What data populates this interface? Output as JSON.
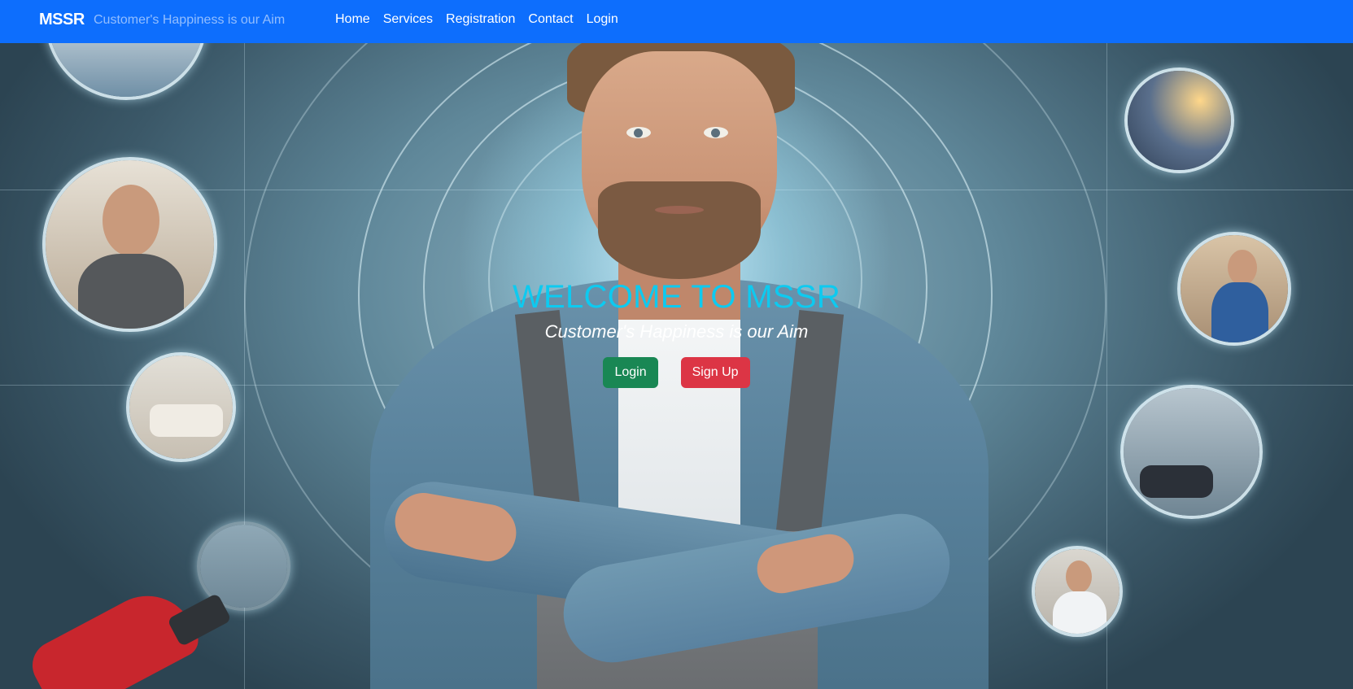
{
  "navbar": {
    "brand": "MSSR",
    "tagline": "Customer's Happiness is our Aim",
    "links": [
      {
        "label": "Home"
      },
      {
        "label": "Services"
      },
      {
        "label": "Registration"
      },
      {
        "label": "Contact"
      },
      {
        "label": "Login"
      }
    ],
    "background_color": "#0d6efd"
  },
  "hero": {
    "title": "WELCOME TO MSSR",
    "subtitle": "Customer's Happiness is our Aim",
    "buttons": {
      "login_label": "Login",
      "signup_label": "Sign Up"
    },
    "title_color": "#0dcaf0",
    "login_color": "#198754",
    "signup_color": "#dc3545",
    "background_image": "mechanic-with-crossed-arms-holographic-interface"
  }
}
